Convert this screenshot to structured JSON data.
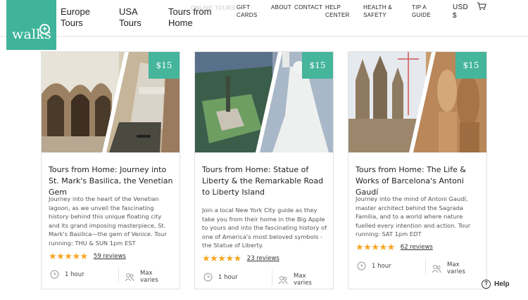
{
  "brand": {
    "logo_text": "walks",
    "accent": "#45b59b"
  },
  "nav": {
    "europe_tours": "Europe\nTours",
    "usa_tours": "USA\nTours",
    "tours_from_home": "Tours from\nHome",
    "online_tours": "ONLINE TOURS",
    "gift_cards": "GIFT\nCARDS",
    "about": "ABOUT",
    "contact": "CONTACT",
    "help_center": "HELP\nCENTER",
    "health_safety": "HEALTH &\nSAFETY",
    "tip_a_guide": "TIP A\nGUIDE",
    "currency": "USD\n$",
    "cart_icon": "cart-icon"
  },
  "cards": [
    {
      "price": "$15",
      "title": "Tours from Home: Journey into St. Mark's Basilica, the Venetian Gem",
      "description": "Journey into the heart of the Venetian lagoon, as we unveil the fascinating history behind this unique floating city and its grand imposing masterpiece, St. Mark's Basilica—the gem of Venice. Tour running: THU & SUN 1pm EST",
      "stars": "★★★★★",
      "reviews": "59 reviews",
      "duration": "1 hour",
      "group": "Max varies",
      "rating": 5
    },
    {
      "price": "$15",
      "title": "Tours from Home: Statue of Liberty & the Remarkable Road to Liberty Island",
      "description": "Join a local New York City guide as they take you from their home in the Big Apple to yours and into the fascinating history of one of America's most beloved symbols - the Statue of Liberty.",
      "stars": "★★★★★",
      "reviews": "23 reviews",
      "duration": "1 hour",
      "group": "Max varies",
      "rating": 5
    },
    {
      "price": "$15",
      "title": "Tours from Home: The Life & Works of Barcelona's Antoni Gaudí",
      "description": "Journey into the mind of Antoni Gaudí, master architect behind the Sagrada Familia, and to a world where nature fuelled every intention and action. Tour running: SAT 1pm EDT",
      "stars": "★★★★★",
      "reviews": "62 reviews",
      "duration": "1 hour",
      "group": "Max varies",
      "rating": 5
    }
  ],
  "help": {
    "label": "Help"
  }
}
